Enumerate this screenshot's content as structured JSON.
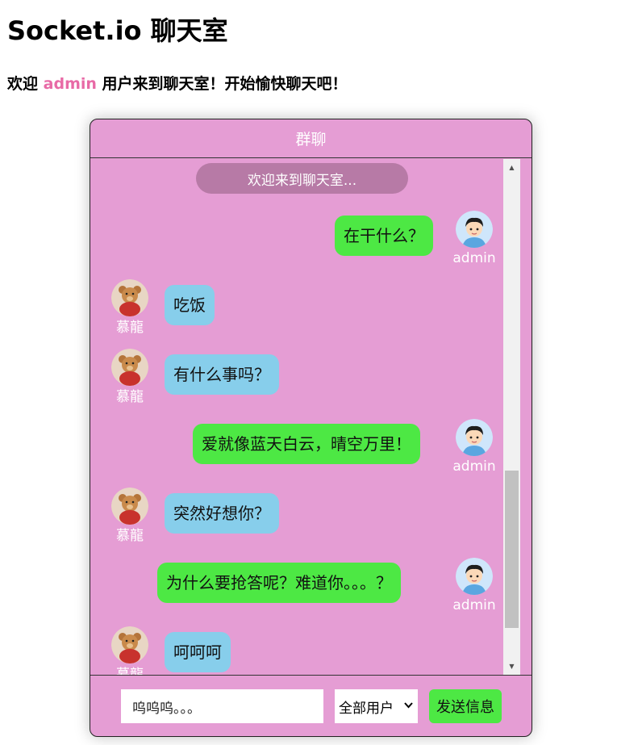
{
  "page": {
    "title": "Socket.io 聊天室",
    "welcome_prefix": "欢迎",
    "welcome_user": "admin",
    "welcome_suffix": "用户来到聊天室！开始愉快聊天吧！"
  },
  "chat": {
    "header_title": "群聊",
    "system_message": "欢迎来到聊天室...",
    "messages": [
      {
        "sender": "admin",
        "mine": true,
        "text": "在干什么？",
        "avatar": "boy-avatar-icon"
      },
      {
        "sender": "慕龍",
        "mine": false,
        "text": "吃饭",
        "avatar": "teddy-bear-avatar-icon"
      },
      {
        "sender": "慕龍",
        "mine": false,
        "text": "有什么事吗？",
        "avatar": "teddy-bear-avatar-icon"
      },
      {
        "sender": "admin",
        "mine": true,
        "text": "爱就像蓝天白云，晴空万里！",
        "avatar": "boy-avatar-icon"
      },
      {
        "sender": "慕龍",
        "mine": false,
        "text": "突然好想你？",
        "avatar": "teddy-bear-avatar-icon"
      },
      {
        "sender": "admin",
        "mine": true,
        "text": "为什么要抢答呢？难道你。。。？",
        "avatar": "boy-avatar-icon"
      },
      {
        "sender": "慕龍",
        "mine": false,
        "text": "呵呵呵",
        "avatar": "teddy-bear-avatar-icon"
      }
    ]
  },
  "composer": {
    "input_value": "呜呜呜。。。",
    "target_selected": "全部用户",
    "send_label": "发送信息"
  },
  "colors": {
    "chat_background": "#e59dd4",
    "my_bubble": "#4de844",
    "their_bubble": "#87ceeb",
    "username_highlight": "#e86aa6",
    "system_pill": "#b77aa6"
  }
}
